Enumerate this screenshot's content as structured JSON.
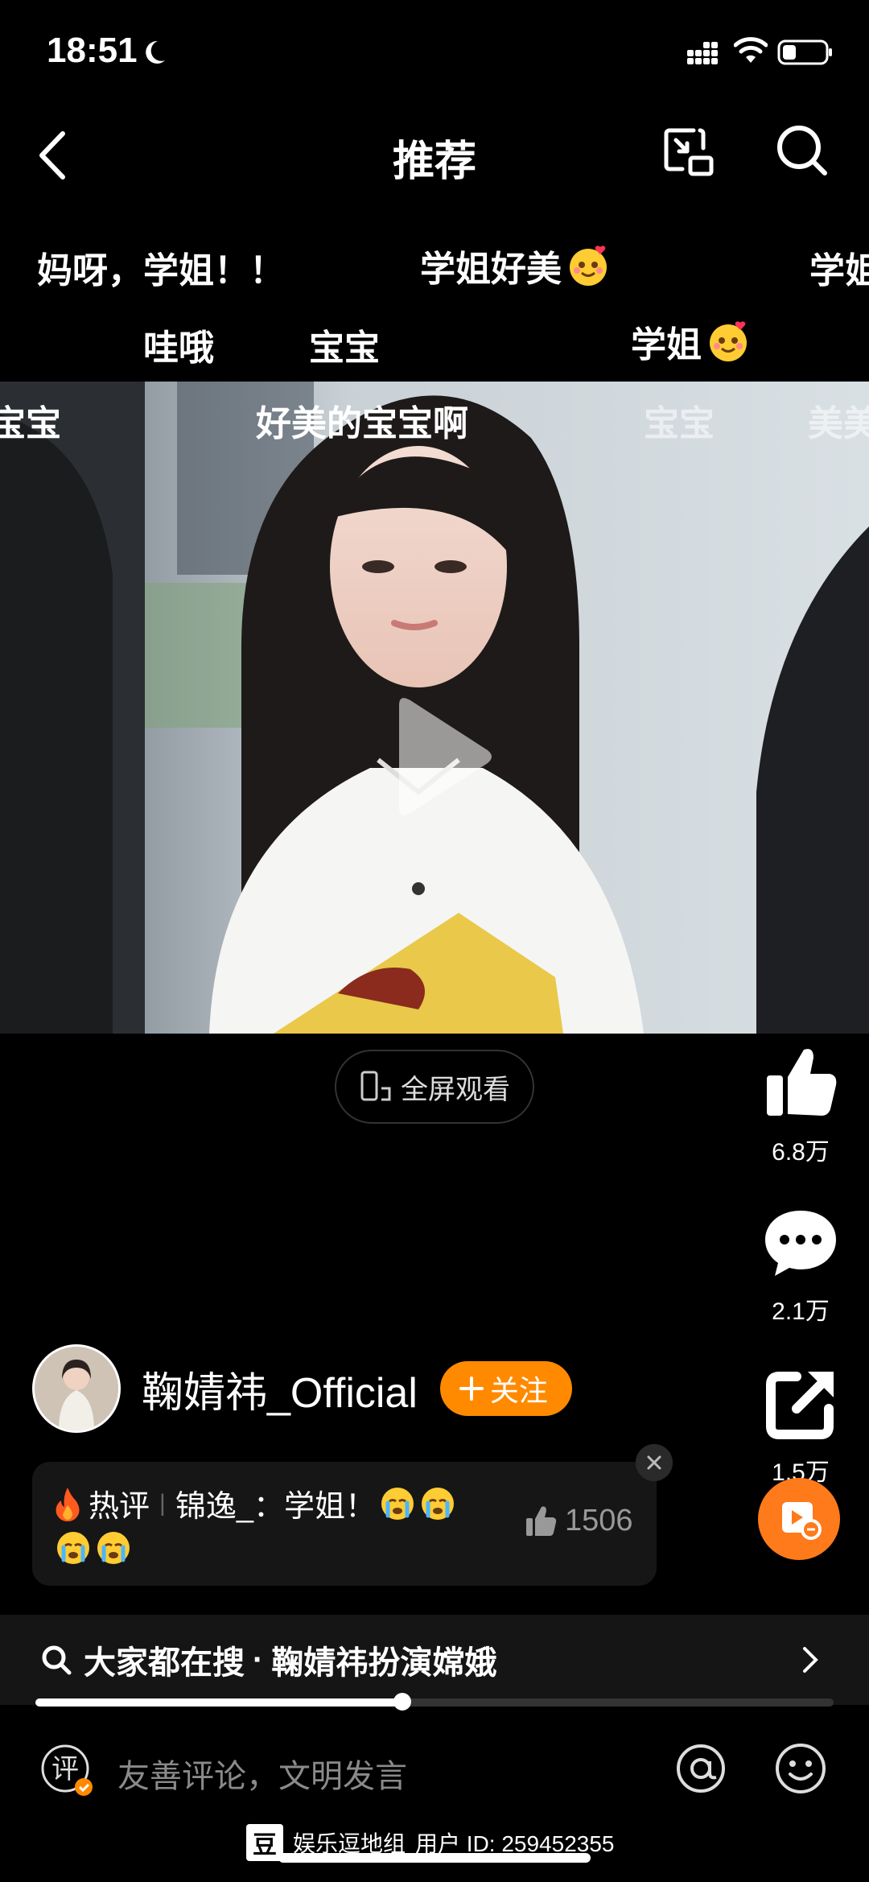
{
  "status_bar": {
    "time": "18:51"
  },
  "nav": {
    "title": "推荐"
  },
  "danmaku": {
    "row1": [
      "妈呀，学姐！！",
      "学姐好美",
      "学姐"
    ],
    "row2": [
      "哇哦",
      "宝宝",
      "学姐"
    ],
    "row3": [
      "宝宝",
      "好美的宝宝啊",
      "宝宝",
      "美美"
    ]
  },
  "player": {
    "fullscreen_label": "全屏观看",
    "progress": 0.46
  },
  "actions": {
    "like_count": "6.8万",
    "comment_count": "2.1万",
    "share_count": "1.5万"
  },
  "author": {
    "name": "鞠婧祎_Official",
    "follow_label": "关注"
  },
  "hot_comment": {
    "tag": "热评",
    "user": "锦逸_",
    "text": "学姐！",
    "likes": "1506"
  },
  "search_suggest": {
    "prefix": "大家都在搜",
    "separator": "·",
    "query": "鞠婧祎扮演嫦娥"
  },
  "comment_input": {
    "icon_label": "评",
    "placeholder": "友善评论，文明发言"
  },
  "watermark": {
    "logo": "豆",
    "group": "娱乐逗地组",
    "user_id": "用户 ID: 259452355"
  },
  "colors": {
    "accent": "#ff8a00",
    "background": "#000000"
  }
}
